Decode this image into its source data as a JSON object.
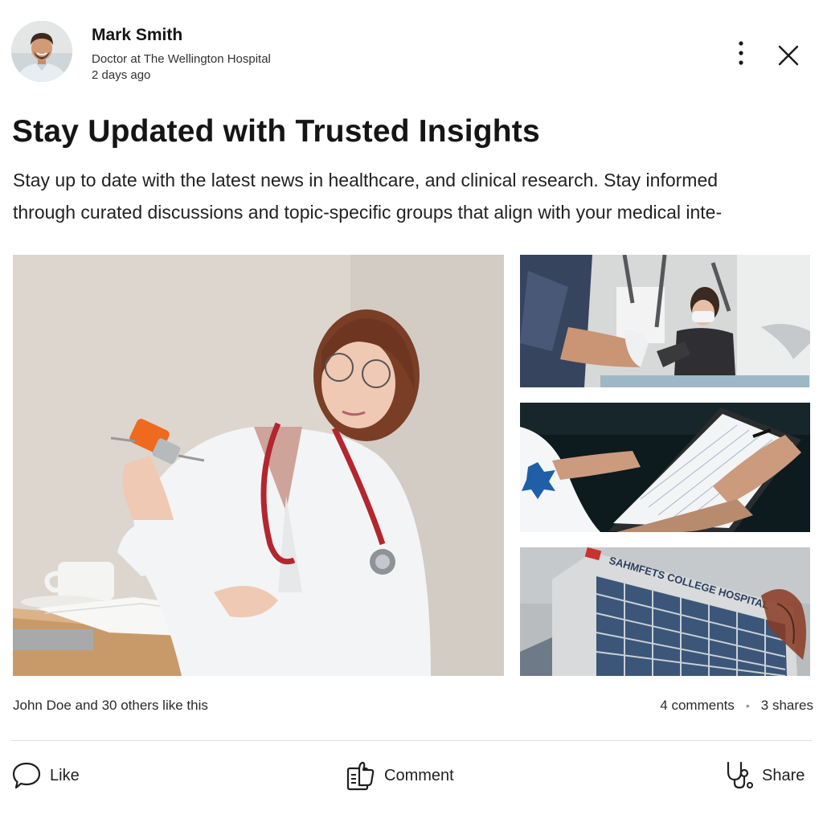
{
  "post": {
    "author_name": "Mark Smith",
    "author_role": "Doctor at The Wellington Hospital",
    "posted_time": "2 days ago",
    "title": "Stay Updated with Trusted Insights",
    "body_line1": "Stay up to date with the latest news in healthcare, and clinical research. Stay informed",
    "body_line2": "through curated discussions and topic-specific groups that align with your medical inte-"
  },
  "images": {
    "building_sign": "SAHMFETS COLLEGE HOSPITAL"
  },
  "stats": {
    "likes_text": "John Doe and 30 others like this",
    "comments_text": "4 comments",
    "separator": "•",
    "shares_text": "3 shares"
  },
  "actions": {
    "like_label": "Like",
    "comment_label": "Comment",
    "share_label": "Share"
  },
  "icons": {
    "like": "speech-bubble-icon",
    "comment": "thumbs-up-document-icon",
    "share": "stethoscope-icon",
    "more": "vertical-ellipsis-icon",
    "close": "close-icon"
  },
  "colors": {
    "text_primary": "#151515",
    "divider": "#dedede",
    "scrub_blue": "#1f5fa8",
    "stethoscope_red": "#b3262e"
  }
}
